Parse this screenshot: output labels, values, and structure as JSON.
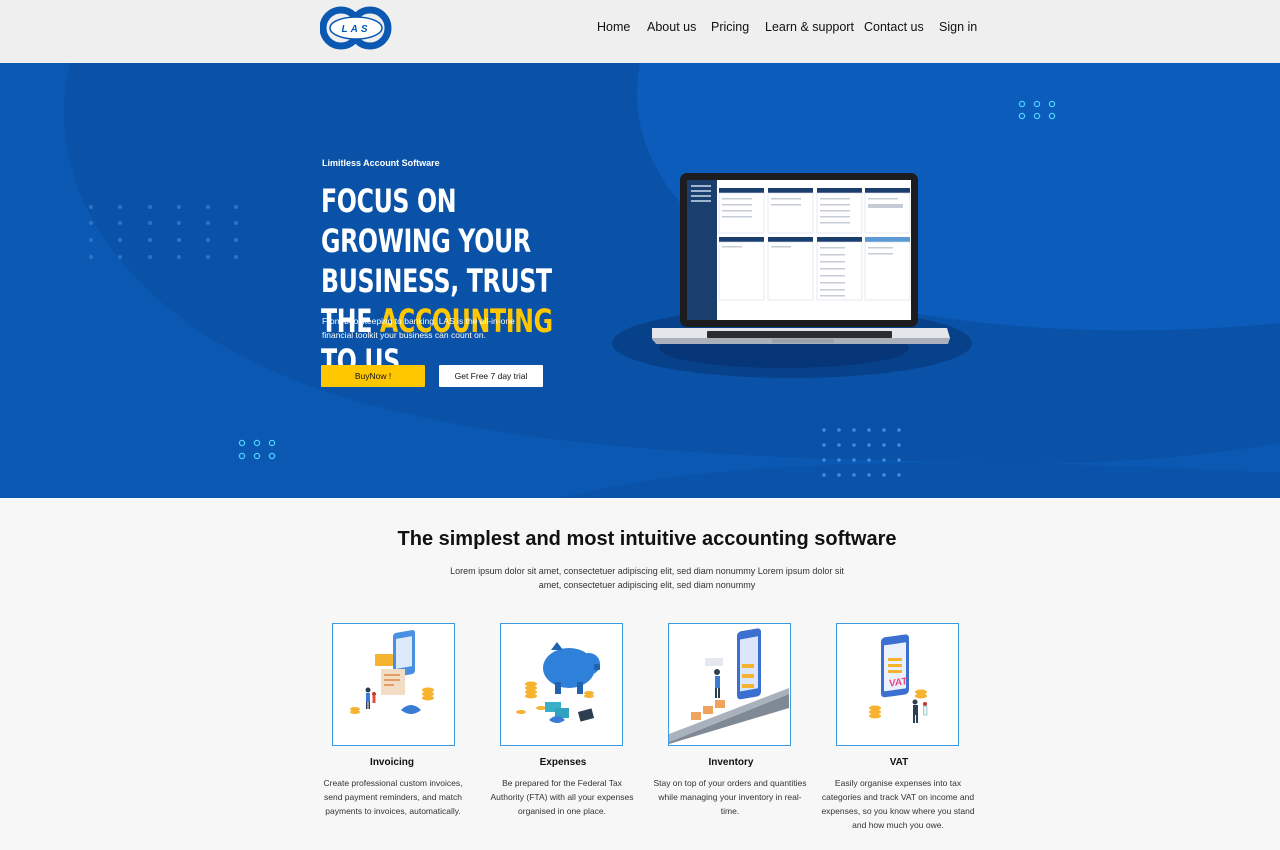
{
  "header": {
    "logo_text": "LAS",
    "nav": [
      "Home",
      "About us",
      "Pricing",
      "Learn & support",
      "Contact us",
      "Sign in"
    ]
  },
  "hero": {
    "eyebrow": "Limitless Account Software",
    "headline_part1": "Focus on growing your business, trust the ",
    "headline_highlight": "accounting",
    "headline_part2": " to us",
    "subtext": "From bookkeeping to banking, LAS is the all-in-one financial toolkit your business can count on.",
    "buy_button": "BuyNow !",
    "trial_button": "Get Free 7 day trial",
    "colors": {
      "background": "#0a58b2",
      "highlight": "#ffc700"
    }
  },
  "features": {
    "title": "The simplest and most intuitive accounting software",
    "description": "Lorem ipsum dolor sit amet, consectetuer adipiscing elit, sed diam nonummy  Lorem ipsum dolor sit amet, consectetuer adipiscing elit, sed diam nonummy",
    "cards": [
      {
        "title": "Invoicing",
        "description": "Create professional custom invoices, send payment reminders, and match payments to invoices, automatically.",
        "illustration": "invoice-phone-illustration"
      },
      {
        "title": "Expenses",
        "description": "Be prepared for the Federal Tax Authority (FTA) with all your expenses organised in one place.",
        "illustration": "piggy-bank-illustration"
      },
      {
        "title": "Inventory",
        "description": "Stay on top of your orders and quantities while managing your inventory in real-time.",
        "illustration": "inventory-conveyor-illustration"
      },
      {
        "title": "VAT",
        "description": "Easily organise expenses into tax categories and track VAT on income and expenses, so you know where you stand and how much you owe.",
        "illustration": "vat-phone-illustration"
      }
    ]
  }
}
